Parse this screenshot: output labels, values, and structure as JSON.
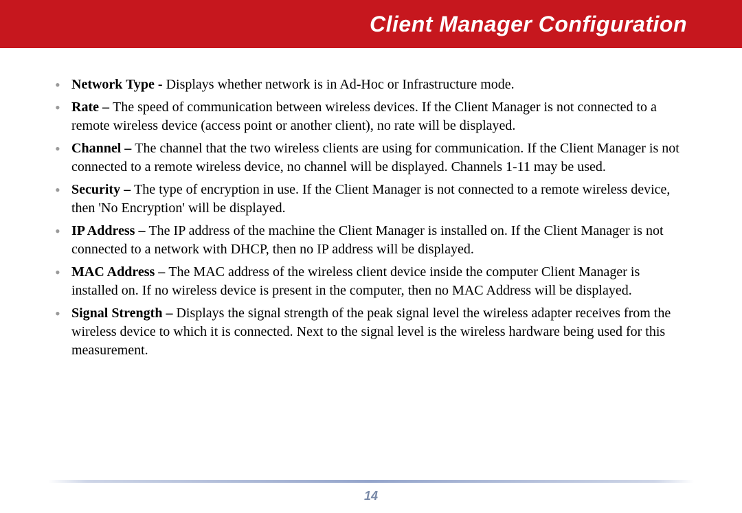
{
  "header": {
    "title": "Client Manager Configuration"
  },
  "items": [
    {
      "term": "Network Type - ",
      "desc": "Displays whether network is in Ad-Hoc or Infrastructure mode."
    },
    {
      "term": "Rate – ",
      "desc": "The speed of communication between wireless devices.  If the Client Manager is not connected to a remote wireless device (access point or another client), no rate will be displayed."
    },
    {
      "term": "Channel – ",
      "desc": "The channel that the two wireless clients are using for communication.  If the Client Manager is not connected to a remote wireless device, no channel will be displayed.  Channels 1-11 may be used."
    },
    {
      "term": "Security – ",
      "desc": "The type of encryption in use.  If the Client Manager is not connected to a remote wireless device, then 'No Encryption' will be displayed."
    },
    {
      "term": "IP Address – ",
      "desc": "The IP address of the machine the Client Manager is installed on. If the Client Manager is not connected to a network with DHCP, then no IP address will be displayed."
    },
    {
      "term": "MAC Address – ",
      "desc": "The MAC address of the wireless client device inside the computer Client Manager is installed on. If no wireless device is present in the computer, then no MAC Address will be displayed."
    },
    {
      "term": "Signal Strength – ",
      "desc": "Displays the signal strength of the peak signal level the wireless adapter receives from the wireless device to which it is connected.  Next to the signal level is the wireless hardware being used for this measurement."
    }
  ],
  "page_number": "14"
}
